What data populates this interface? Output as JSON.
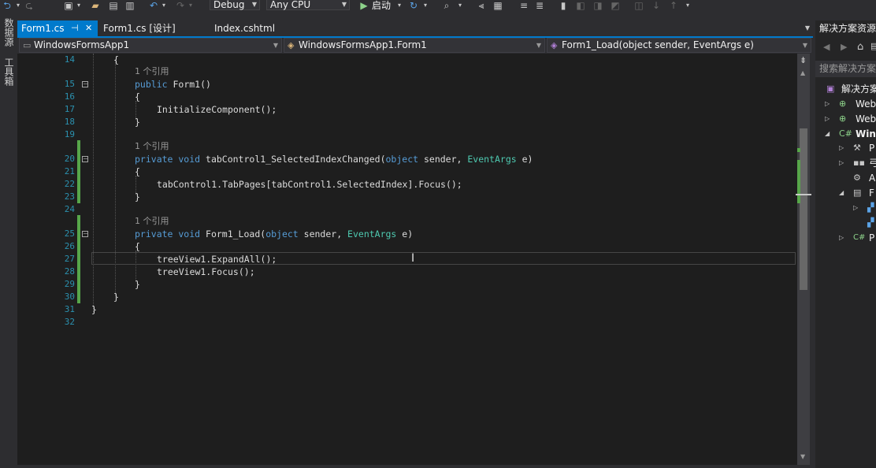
{
  "toolbar": {
    "config": "Debug",
    "platform": "Any CPU",
    "start_label": "启动"
  },
  "side_strip": {
    "datasource": "数据源",
    "toolbox": "工具箱"
  },
  "tabs": [
    {
      "label": "Form1.cs",
      "pin": "⊣",
      "close": "✕"
    },
    {
      "label": "Form1.cs [设计]"
    },
    {
      "label": "Index.cshtml"
    }
  ],
  "navbar": {
    "project": "WindowsFormsApp1",
    "class": "WindowsFormsApp1.Form1",
    "member": "Form1_Load(object sender, EventArgs e)"
  },
  "code": {
    "line_numbers": [
      "14",
      "15",
      "16",
      "17",
      "18",
      "19",
      "20",
      "21",
      "22",
      "23",
      "24",
      "25",
      "26",
      "27",
      "28",
      "29",
      "30",
      "31",
      "32"
    ],
    "ref_label": "1 个引用",
    "l14": "{",
    "l15_kw": "public",
    "l15_rest": " Form1()",
    "l16": "{",
    "l17": "InitializeComponent();",
    "l18": "}",
    "l20_kw": "private void",
    "l20_a": " tabControl1_SelectedIndexChanged(",
    "l20_kw2": "object",
    "l20_b": " sender, ",
    "l20_ty": "EventArgs",
    "l20_c": " e)",
    "l21": "{",
    "l22": "tabControl1.TabPages[tabControl1.SelectedIndex].Focus();",
    "l23": "}",
    "l25_kw": "private void",
    "l25_a": " Form1_Load(",
    "l25_kw2": "object",
    "l25_b": " sender, ",
    "l25_ty": "EventArgs",
    "l25_c": " e)",
    "l26": "{",
    "l27": "treeView1.ExpandAll();",
    "l28": "treeView1.Focus();",
    "l29": "}",
    "l30": "}",
    "l31": "}"
  },
  "solution_explorer": {
    "title": "解决方案资源",
    "search_placeholder": "搜索解决方案",
    "items": [
      {
        "label": "解决方案"
      },
      {
        "label": "Web"
      },
      {
        "label": "Web"
      },
      {
        "label": "Win"
      },
      {
        "label": "P"
      },
      {
        "label": "弓"
      },
      {
        "label": "A"
      },
      {
        "label": "F"
      },
      {
        "label": ""
      },
      {
        "label": ""
      },
      {
        "label": "P"
      }
    ]
  },
  "colors": {
    "accent": "#007acc",
    "keyword": "#569cd6",
    "type": "#4ec9b0",
    "line_number": "#2b91af",
    "changed_bar": "#57a64a"
  }
}
